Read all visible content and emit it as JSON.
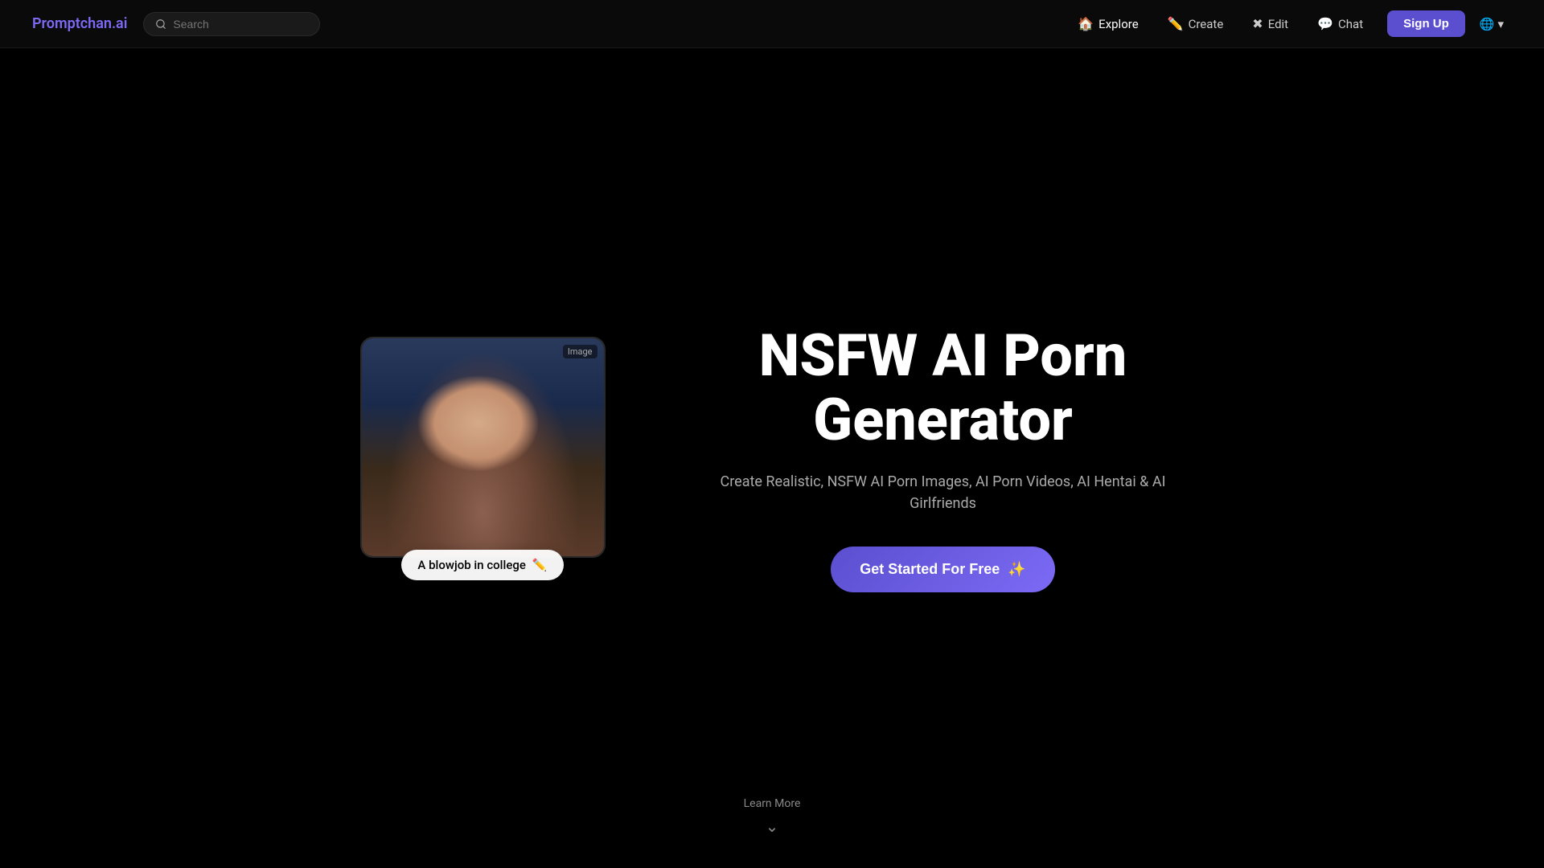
{
  "brand": {
    "name": "Promptchan",
    "suffix": ".ai"
  },
  "navbar": {
    "search_placeholder": "Search",
    "items": [
      {
        "id": "explore",
        "label": "Explore",
        "icon": "🏠",
        "active": true
      },
      {
        "id": "create",
        "label": "Create",
        "icon": "✏️",
        "active": false
      },
      {
        "id": "edit",
        "label": "Edit",
        "icon": "✖",
        "active": false
      },
      {
        "id": "chat",
        "label": "Chat",
        "icon": "💬",
        "active": false
      }
    ],
    "signup_label": "Sign Up",
    "globe_label": "🌐"
  },
  "hero": {
    "title_line1": "NSFW AI Porn",
    "title_line2": "Generator",
    "subtitle": "Create Realistic, NSFW AI Porn Images, AI Porn Videos, AI Hentai & AI Girlfriends",
    "cta_label": "Get Started For Free",
    "cta_icon": "✨",
    "image_tag": "Image",
    "image_prompt": "A blowjob in college",
    "image_prompt_icon": "✏️"
  },
  "learn_more": {
    "label": "Learn More",
    "icon": "chevron-down"
  },
  "colors": {
    "accent": "#5b4fcf",
    "accent_light": "#7c6af5",
    "bg": "#000000",
    "navbar_bg": "#0a0a0a"
  }
}
